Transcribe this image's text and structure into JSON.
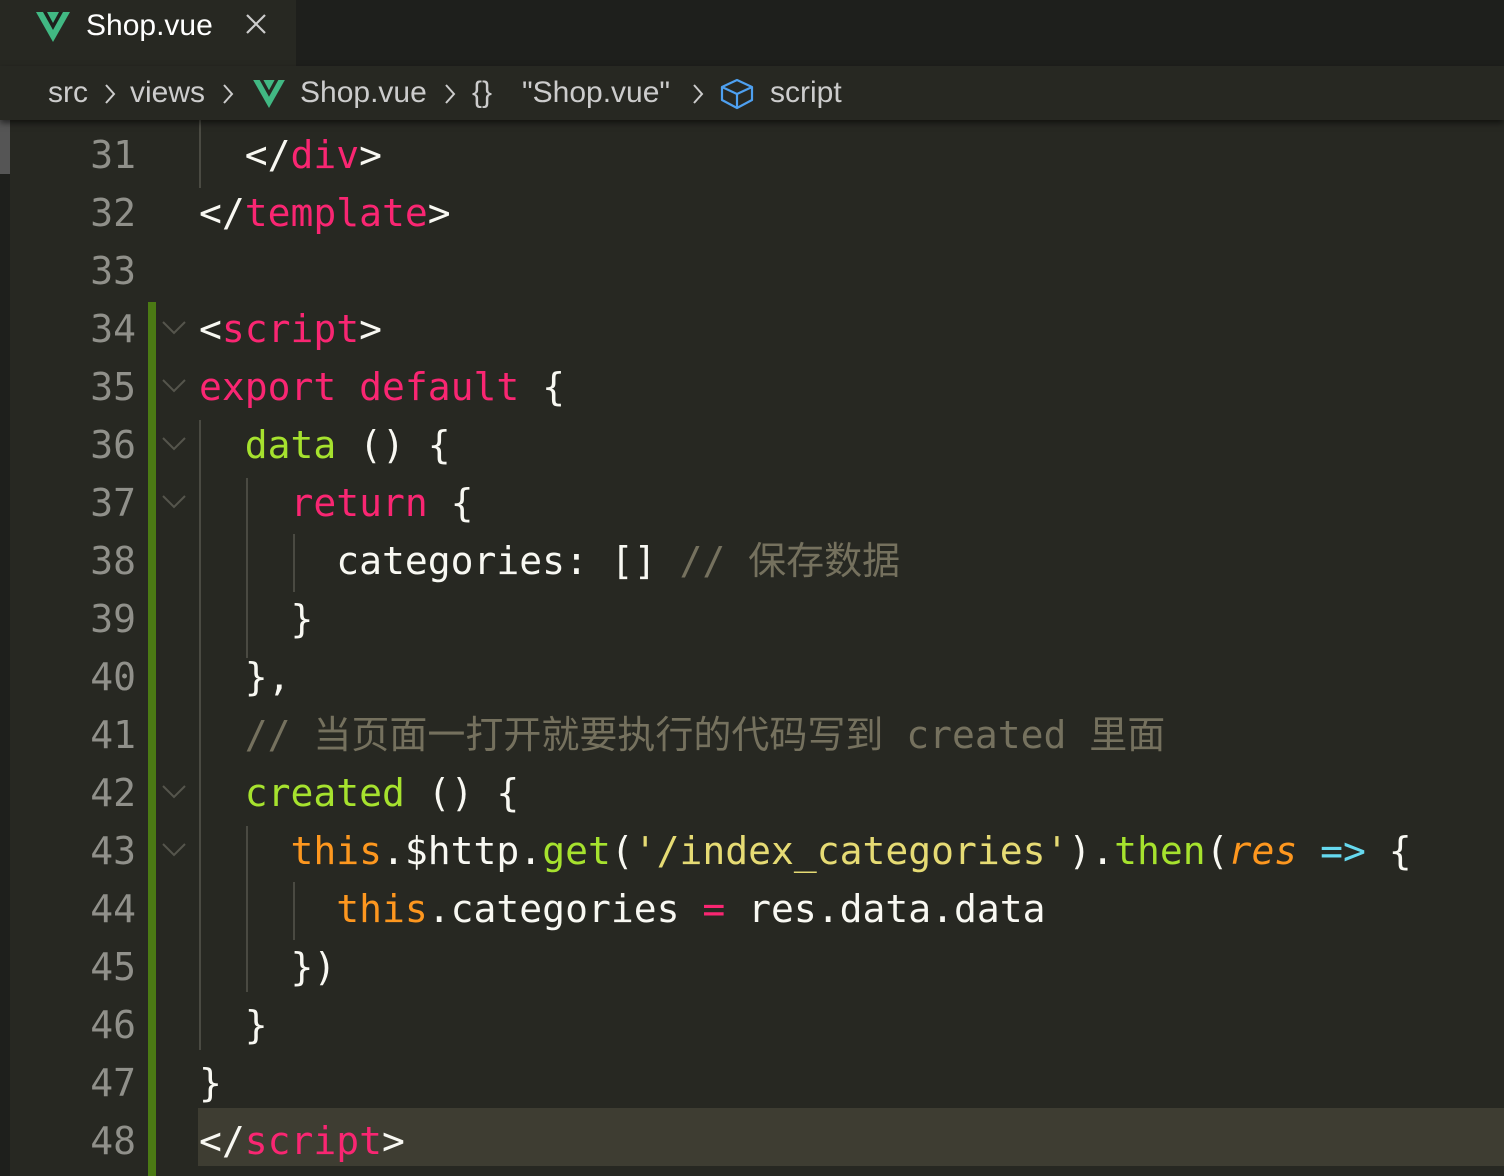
{
  "tab": {
    "title": "Shop.vue"
  },
  "breadcrumb": {
    "items": [
      "src",
      "views",
      "Shop.vue",
      "{}",
      "\"Shop.vue\"",
      "script"
    ]
  },
  "colors": {
    "background": "#272822",
    "keyword": "#f92672",
    "function": "#a6e22e",
    "this": "#fd971f",
    "string": "#e6db74",
    "comment": "#75715e",
    "vue_green": "#41b883",
    "git_modified": "#4b7a14"
  },
  "icons": {
    "tab": "vue-file-icon",
    "close": "close-icon",
    "breadcrumb_file": "vue-file-icon",
    "breadcrumb_symbol": "cube-icon"
  },
  "editor": {
    "active_line": 48,
    "lines": [
      {
        "num": "31",
        "tokens": [
          {
            "t": "  </",
            "c": ""
          },
          {
            "t": "div",
            "c": "tk-tag"
          },
          {
            "t": ">",
            "c": ""
          }
        ]
      },
      {
        "num": "32",
        "tokens": [
          {
            "t": "</",
            "c": ""
          },
          {
            "t": "template",
            "c": "tk-tag"
          },
          {
            "t": ">",
            "c": ""
          }
        ]
      },
      {
        "num": "33",
        "tokens": []
      },
      {
        "num": "34",
        "tokens": [
          {
            "t": "<",
            "c": ""
          },
          {
            "t": "script",
            "c": "tk-tag"
          },
          {
            "t": ">",
            "c": ""
          }
        ]
      },
      {
        "num": "35",
        "tokens": [
          {
            "t": "export default",
            "c": "tk-kw"
          },
          {
            "t": " {",
            "c": ""
          }
        ]
      },
      {
        "num": "36",
        "tokens": [
          {
            "t": "  ",
            "c": ""
          },
          {
            "t": "data",
            "c": "tk-fn"
          },
          {
            "t": " () {",
            "c": ""
          }
        ]
      },
      {
        "num": "37",
        "tokens": [
          {
            "t": "    ",
            "c": ""
          },
          {
            "t": "return",
            "c": "tk-kw"
          },
          {
            "t": " {",
            "c": ""
          }
        ]
      },
      {
        "num": "38",
        "tokens": [
          {
            "t": "      categories: [] ",
            "c": ""
          },
          {
            "t": "// 保存数据",
            "c": "tk-cm"
          }
        ]
      },
      {
        "num": "39",
        "tokens": [
          {
            "t": "    }",
            "c": ""
          }
        ]
      },
      {
        "num": "40",
        "tokens": [
          {
            "t": "  },",
            "c": ""
          }
        ]
      },
      {
        "num": "41",
        "tokens": [
          {
            "t": "  ",
            "c": ""
          },
          {
            "t": "// 当页面一打开就要执行的代码写到 created 里面",
            "c": "tk-cm"
          }
        ]
      },
      {
        "num": "42",
        "tokens": [
          {
            "t": "  ",
            "c": ""
          },
          {
            "t": "created",
            "c": "tk-fn"
          },
          {
            "t": " () {",
            "c": ""
          }
        ]
      },
      {
        "num": "43",
        "tokens": [
          {
            "t": "    ",
            "c": ""
          },
          {
            "t": "this",
            "c": "tk-this"
          },
          {
            "t": ".$http.",
            "c": ""
          },
          {
            "t": "get",
            "c": "tk-fn"
          },
          {
            "t": "(",
            "c": ""
          },
          {
            "t": "'/index_categories'",
            "c": "tk-str"
          },
          {
            "t": ").",
            "c": ""
          },
          {
            "t": "then",
            "c": "tk-fn"
          },
          {
            "t": "(",
            "c": ""
          },
          {
            "t": "res",
            "c": "tk-param"
          },
          {
            "t": " ",
            "c": ""
          },
          {
            "t": "=>",
            "c": "tk-arrow"
          },
          {
            "t": " {",
            "c": ""
          }
        ]
      },
      {
        "num": "44",
        "tokens": [
          {
            "t": "      ",
            "c": ""
          },
          {
            "t": "this",
            "c": "tk-this"
          },
          {
            "t": ".categories ",
            "c": ""
          },
          {
            "t": "=",
            "c": "tk-kw"
          },
          {
            "t": " res.data.data",
            "c": ""
          }
        ]
      },
      {
        "num": "45",
        "tokens": [
          {
            "t": "    })",
            "c": ""
          }
        ]
      },
      {
        "num": "46",
        "tokens": [
          {
            "t": "  }",
            "c": ""
          }
        ]
      },
      {
        "num": "47",
        "tokens": [
          {
            "t": "}",
            "c": ""
          }
        ]
      },
      {
        "num": "48",
        "tokens": [
          {
            "t": "</",
            "c": ""
          },
          {
            "t": "script",
            "c": "tk-tag"
          },
          {
            "t": ">",
            "c": ""
          }
        ]
      }
    ]
  }
}
